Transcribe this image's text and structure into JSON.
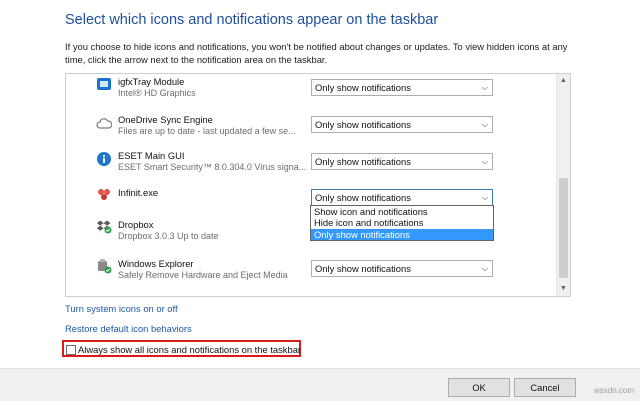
{
  "title": "Select which icons and notifications appear on the taskbar",
  "description": "If you choose to hide icons and notifications, you won't be notified about changes or updates. To view hidden icons at any time, click the arrow next to the notification area on the taskbar.",
  "items": [
    {
      "name": "igfxTray Module",
      "sub": "Intel® HD Graphics",
      "icon": "intel-graphics-icon",
      "behavior": "Only show notifications"
    },
    {
      "name": "OneDrive Sync Engine",
      "sub": "Files are up to date - last updated a few se...",
      "icon": "onedrive-cloud-icon",
      "behavior": "Only show notifications"
    },
    {
      "name": "ESET Main GUI",
      "sub": "ESET Smart Security™ 8.0.304.0 Virus signa...",
      "icon": "eset-info-icon",
      "behavior": "Only show notifications"
    },
    {
      "name": "Infinit.exe",
      "sub": "",
      "icon": "infinit-icon",
      "behavior": "Only show notifications"
    },
    {
      "name": "Dropbox",
      "sub": "Dropbox 3.0.3 Up to date",
      "icon": "dropbox-icon",
      "behavior": "Only show notifications"
    },
    {
      "name": "Windows Explorer",
      "sub": "Safely Remove Hardware and Eject Media",
      "icon": "safely-remove-hardware-icon",
      "behavior": "Only show notifications"
    }
  ],
  "dropdown": {
    "options": [
      "Show icon and notifications",
      "Hide icon and notifications",
      "Only show notifications"
    ],
    "selected": "Only show notifications"
  },
  "links": {
    "system_icons": "Turn system icons on or off",
    "restore": "Restore default icon behaviors"
  },
  "always_show_label": "Always show all icons and notifications on the taskbar",
  "buttons": {
    "ok": "OK",
    "cancel": "Cancel"
  },
  "watermark": "wsxdn.com",
  "colors": {
    "title": "#1e4f9c",
    "link": "#1e5aa8",
    "highlight": "#3399ff",
    "annotation": "#d91c1c"
  }
}
